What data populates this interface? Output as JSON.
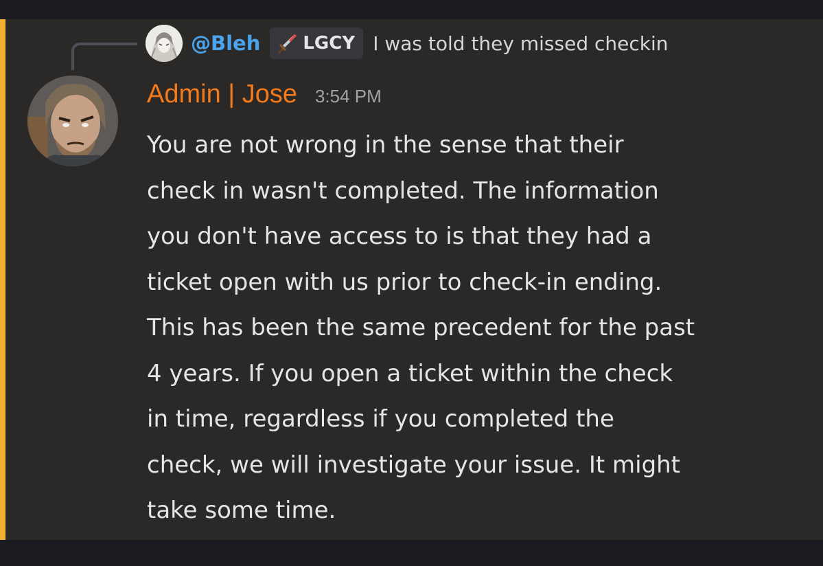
{
  "reply": {
    "author": "@Bleh",
    "tag": "LGCY",
    "tag_icon": "sword-icon",
    "text": "I was told they missed checkin"
  },
  "message": {
    "author": "Admin | Jose",
    "timestamp": "3:54 PM",
    "lines": [
      "You are not wrong in the sense that their",
      "check in wasn't completed. The information",
      "you don't have access to is that they had a",
      "ticket open with us prior to check-in ending.",
      "This has been the same precedent for the past",
      "4 years. If you open a ticket within the check",
      "in time, regardless if you completed the",
      "check, we will investigate your issue. It might",
      "take some time."
    ]
  },
  "colors": {
    "background": "#2b2928",
    "frame": "#1b1c21",
    "mention_bar": "#f0b132",
    "reply_author": "#4aa3ed",
    "author": "#f27a1a",
    "timestamp": "#a2a2ab",
    "body_text": "#e6e4e6"
  }
}
